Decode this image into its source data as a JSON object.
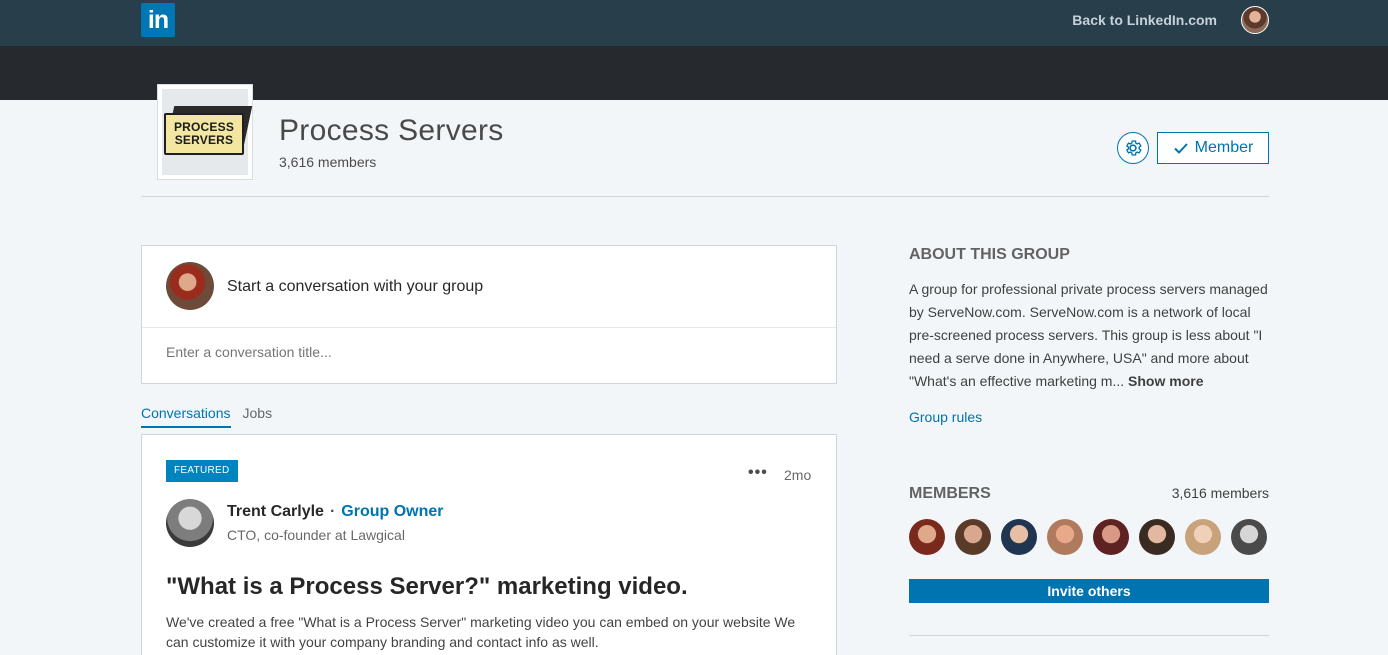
{
  "topbar": {
    "logo_text": "in",
    "back_link": "Back to LinkedIn.com"
  },
  "group": {
    "logo_line1": "PROCESS",
    "logo_line2": "SERVERS",
    "title": "Process Servers",
    "members": "3,616 members",
    "member_button": "Member"
  },
  "composer": {
    "prompt": "Start a conversation with your group",
    "title_placeholder": "Enter a conversation title..."
  },
  "tabs": [
    {
      "label": "Conversations",
      "active": true
    },
    {
      "label": "Jobs",
      "active": false
    }
  ],
  "post": {
    "badge": "FEATURED",
    "time": "2mo",
    "more": "•••",
    "author_name": "Trent Carlyle",
    "separator": "·",
    "author_role": "Group Owner",
    "author_headline": "CTO, co-founder at Lawgical",
    "title": "\"What is a Process Server?\" marketing video.",
    "body": "We've created a free \"What is a Process Server\" marketing video you can embed on your website We can customize it with your company branding and contact info as well."
  },
  "about": {
    "heading": "ABOUT THIS GROUP",
    "text": "A group for professional private process servers managed by ServeNow.com. ServeNow.com is a network of local pre-screened process servers. This group is less about \"I need a serve done in Anywhere, USA\" and more about \"What's an effective marketing m...",
    "show_more": "Show more",
    "rules_link": "Group rules"
  },
  "members_panel": {
    "heading": "MEMBERS",
    "count": "3,616 members",
    "invite_button": "Invite others",
    "faces": [
      {
        "skin": "#e0a88a",
        "hair": "#7a2a1c"
      },
      {
        "skin": "#d8a78e",
        "hair": "#5a3b2a"
      },
      {
        "skin": "#e6bfa5",
        "hair": "#1f3550"
      },
      {
        "skin": "#e8a98a",
        "hair": "#b07a5e"
      },
      {
        "skin": "#d89a86",
        "hair": "#5e2222"
      },
      {
        "skin": "#e2b8a0",
        "hair": "#3a2b22"
      },
      {
        "skin": "#f0d0b8",
        "hair": "#c8a27a"
      },
      {
        "skin": "#d6d6d6",
        "hair": "#4a4a4a"
      }
    ]
  },
  "colors": {
    "brand": "#0073b1",
    "topbar": "#283e4a",
    "band": "#262a2e"
  }
}
